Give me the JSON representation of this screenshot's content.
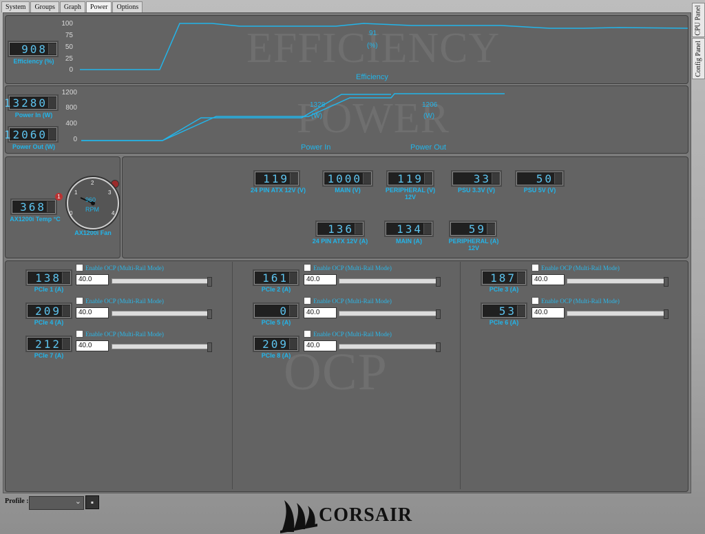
{
  "tabs": [
    "System",
    "Groups",
    "Graph",
    "Power",
    "Options"
  ],
  "active_tab": "Power",
  "side_tabs": [
    "CPU Panel",
    "Config Panel"
  ],
  "efficiency": {
    "label": "Efficiency  (%)",
    "readout": "908",
    "watermark": "EFFICIENCY",
    "ticks": [
      "100",
      "75",
      "50",
      "25",
      "0"
    ],
    "current_value": "91",
    "current_unit": "(%)",
    "series_label": "Efficiency"
  },
  "power": {
    "in_label": "Power In  (W)",
    "in_readout": "13280",
    "out_label": "Power Out  (W)",
    "out_readout": "12060",
    "watermark": "POWER",
    "ticks": [
      "1200",
      "800",
      "400",
      "0"
    ],
    "in_value": "1328",
    "in_unit": "(W)",
    "out_value": "1206",
    "out_unit": "(W)",
    "in_series": "Power In",
    "out_series": "Power Out"
  },
  "temp": {
    "readout": "368",
    "label": "AX1200i Temp  °C",
    "badge": "1"
  },
  "fan": {
    "label": "AX1200i Fan",
    "value": "960",
    "unit": "RPM",
    "scale": [
      "0",
      "1",
      "2",
      "3",
      "4"
    ]
  },
  "voltages": [
    {
      "readout": "119",
      "label": "24 PIN ATX  12V  (V)"
    },
    {
      "readout": "1000",
      "label": "MAIN  (V)"
    },
    {
      "readout": "119",
      "label": "PERIPHERAL  (V)\n12V"
    },
    {
      "readout": "33",
      "label": "PSU 3.3V  (V)"
    },
    {
      "readout": "50",
      "label": "PSU 5V  (V)"
    }
  ],
  "currents": [
    {
      "readout": "136",
      "label": "24 PIN ATX  12V  (A)"
    },
    {
      "readout": "134",
      "label": "MAIN  (A)"
    },
    {
      "readout": "59",
      "label": "PERIPHERAL  (A)\n12V"
    }
  ],
  "ocp": {
    "watermark": "OCP",
    "checkbox_label": "Enable OCP (Multi-Rail Mode)",
    "rails": [
      {
        "readout": "138",
        "label": "PCIe 1  (A)",
        "value": "40.0"
      },
      {
        "readout": "161",
        "label": "PCIe 2  (A)",
        "value": "40.0"
      },
      {
        "readout": "187",
        "label": "PCIe 3  (A)",
        "value": "40.0"
      },
      {
        "readout": "209",
        "label": "PCIe 4  (A)",
        "value": "40.0"
      },
      {
        "readout": "0",
        "label": "PCIe 5  (A)",
        "value": "40.0"
      },
      {
        "readout": "53",
        "label": "PCIe 6  (A)",
        "value": "40.0"
      },
      {
        "readout": "212",
        "label": "PCIe 7  (A)",
        "value": "40.0"
      },
      {
        "readout": "209",
        "label": "PCIe 8  (A)",
        "value": "40.0"
      }
    ]
  },
  "footer": {
    "profile_label": "Profile :",
    "brand": "CORSAIR"
  },
  "colors": {
    "accent": "#22b5ea",
    "panel": "#636363",
    "lcd_bg": "#202020"
  }
}
